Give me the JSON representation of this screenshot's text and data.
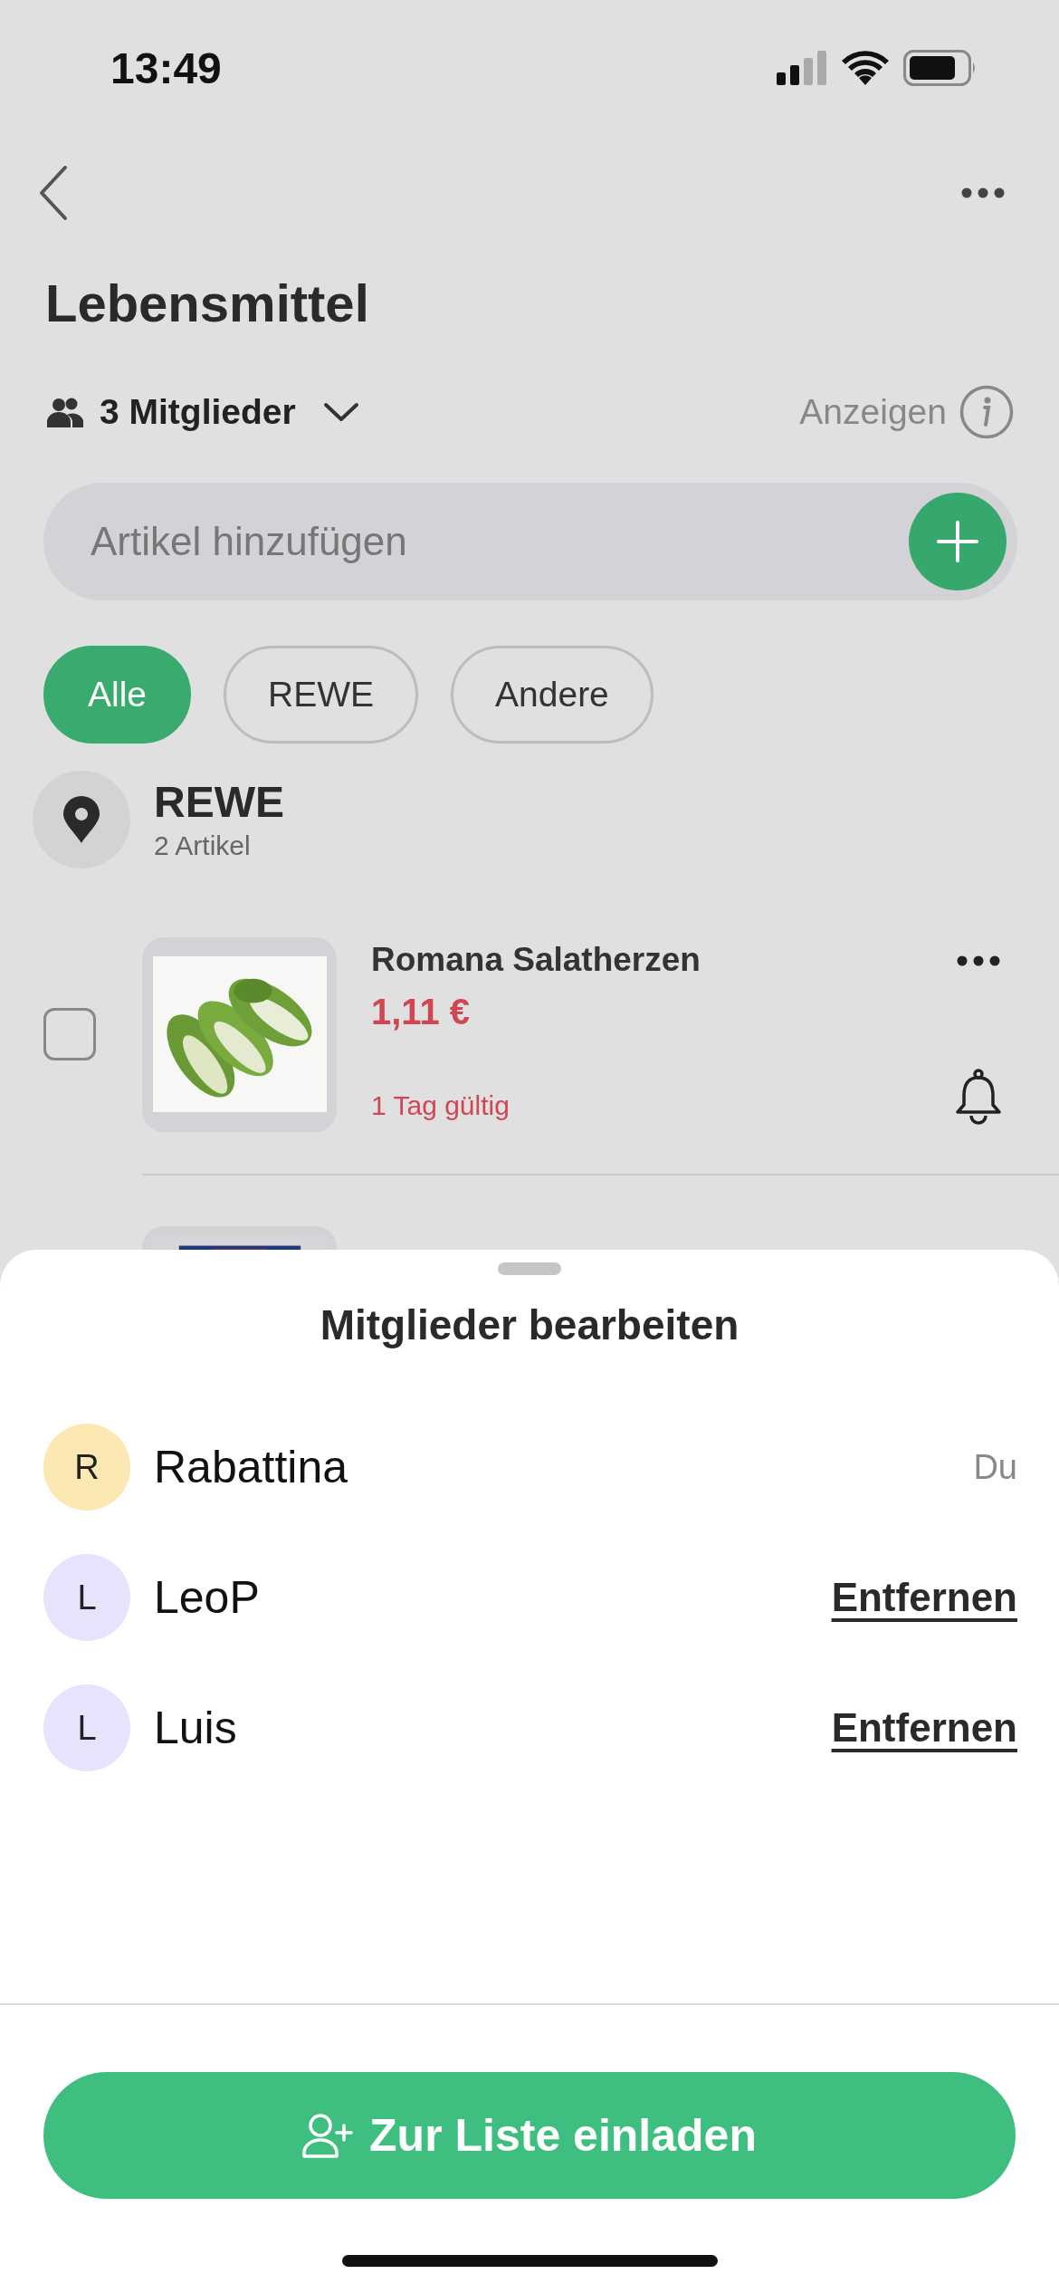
{
  "status_bar": {
    "time": "13:49"
  },
  "header": {
    "title": "Lebensmittel",
    "members_label": "3 Mitglieder",
    "show_label": "Anzeigen"
  },
  "search": {
    "placeholder": "Artikel hinzufügen"
  },
  "filters": [
    {
      "label": "Alle",
      "selected": true
    },
    {
      "label": "REWE",
      "selected": false
    },
    {
      "label": "Andere",
      "selected": false
    }
  ],
  "store": {
    "name": "REWE",
    "count": "2 Artikel"
  },
  "items": [
    {
      "name": "Romana Salatherzen",
      "price": "1,11 €",
      "validity": "1 Tag gültig",
      "checked": false,
      "image": {
        "kind": "picture"
      }
    },
    {
      "image": {
        "kind": "picture"
      }
    }
  ],
  "sheet": {
    "title": "Mitglieder bearbeiten",
    "members": [
      {
        "initial": "R",
        "name": "Rabattina",
        "color": "#fbe8b2",
        "kind": "self",
        "action": "Du"
      },
      {
        "initial": "L",
        "name": "LeoP",
        "color": "#e9e2fd",
        "kind": "remove",
        "action": "Entfernen"
      },
      {
        "initial": "L",
        "name": "Luis",
        "color": "#e9e2fd",
        "kind": "remove",
        "action": "Entfernen"
      }
    ],
    "invite_button": "Zur Liste einladen"
  }
}
